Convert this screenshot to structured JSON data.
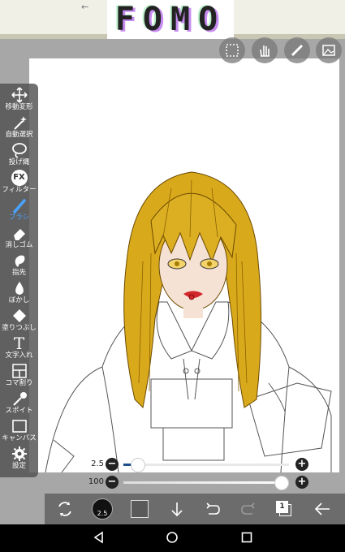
{
  "banner": {
    "title": "FOMO",
    "back_glyph": "←"
  },
  "top_tools": [
    {
      "name": "selection-icon"
    },
    {
      "name": "hand-icon"
    },
    {
      "name": "ruler-icon"
    },
    {
      "name": "image-icon"
    }
  ],
  "sidebar": {
    "tools": [
      {
        "label": "移動変形",
        "icon": "move-icon"
      },
      {
        "label": "自動選択",
        "icon": "magic-wand-icon"
      },
      {
        "label": "投げ縄",
        "icon": "lasso-icon"
      },
      {
        "label": "フィルター",
        "icon": "fx-icon",
        "glyph": "FX"
      },
      {
        "label": "ブラシ",
        "icon": "brush-icon",
        "active": true
      },
      {
        "label": "消しゴム",
        "icon": "eraser-icon"
      },
      {
        "label": "指先",
        "icon": "finger-icon"
      },
      {
        "label": "ぼかし",
        "icon": "blur-icon"
      },
      {
        "label": "塗りつぶし",
        "icon": "fill-icon"
      },
      {
        "label": "文字入れ",
        "icon": "text-icon",
        "glyph": "T"
      },
      {
        "label": "コマ割り",
        "icon": "frame-icon"
      },
      {
        "label": "スポイト",
        "icon": "eyedropper-icon"
      },
      {
        "label": "キャンバス",
        "icon": "canvas-icon"
      },
      {
        "label": "設定",
        "icon": "settings-icon"
      }
    ]
  },
  "sliders": {
    "brush_size": {
      "value": "2.5",
      "fraction": 0.05
    },
    "opacity": {
      "value": "100",
      "fraction": 1.0
    }
  },
  "bottom": {
    "brush_size_badge": "2.5",
    "layer_count": "1",
    "color_swatch": "#5a5a5a"
  },
  "colors": {
    "accent": "#4aa3ff",
    "hair": "#d9a91c"
  }
}
